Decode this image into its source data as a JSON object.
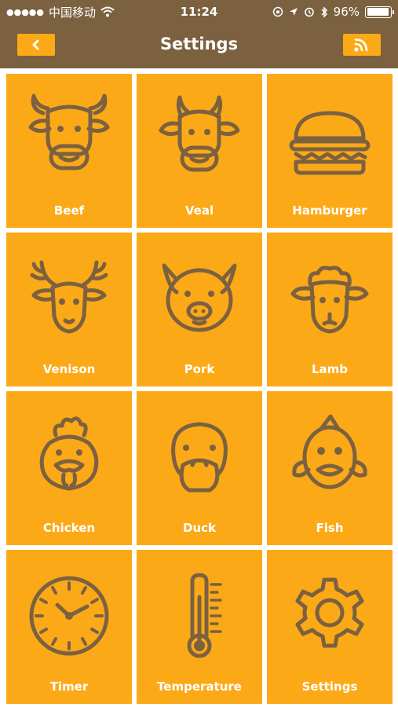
{
  "status_bar": {
    "carrier": "中国移动",
    "time": "11:24",
    "battery": "96%"
  },
  "nav": {
    "title": "Settings"
  },
  "tiles": [
    {
      "label": "Beef",
      "icon": "cow-icon"
    },
    {
      "label": "Veal",
      "icon": "calf-icon"
    },
    {
      "label": "Hamburger",
      "icon": "hamburger-icon"
    },
    {
      "label": "Venison",
      "icon": "deer-icon"
    },
    {
      "label": "Pork",
      "icon": "pig-icon"
    },
    {
      "label": "Lamb",
      "icon": "sheep-icon"
    },
    {
      "label": "Chicken",
      "icon": "chicken-icon"
    },
    {
      "label": "Duck",
      "icon": "duck-icon"
    },
    {
      "label": "Fish",
      "icon": "fish-icon"
    },
    {
      "label": "Timer",
      "icon": "clock-icon"
    },
    {
      "label": "Temperature",
      "icon": "thermometer-icon"
    },
    {
      "label": "Settings",
      "icon": "gear-icon"
    }
  ],
  "colors": {
    "brand_brown": "#7b6140",
    "tile_orange": "#fca918",
    "label_white": "#ffffff"
  }
}
